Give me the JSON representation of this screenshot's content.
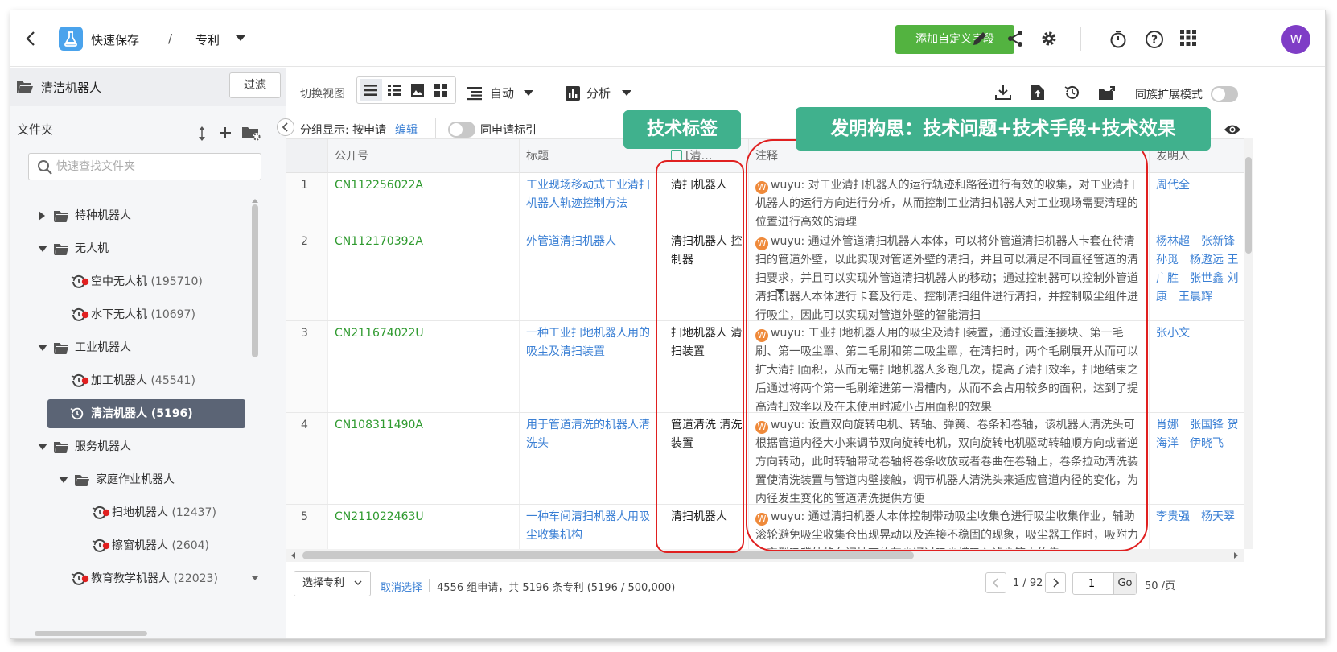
{
  "header": {
    "project": "快速保存",
    "separator": "/",
    "module": "专利",
    "add_field_button": "添加自定义字段",
    "avatar_initial": "W",
    "accent_color": "#53b340"
  },
  "left_panel": {
    "current_folder": "清洁机器人",
    "filter_button": "过滤",
    "folder_label": "文件夹",
    "search_placeholder": "快速查找文件夹",
    "tree": [
      {
        "label": "特种机器人",
        "count": ""
      },
      {
        "label": "无人机",
        "count": ""
      },
      {
        "label": "空中无人机",
        "count": "(195710)"
      },
      {
        "label": "水下无人机",
        "count": "(10697)"
      },
      {
        "label": "工业机器人",
        "count": ""
      },
      {
        "label": "加工机器人",
        "count": "(45541)"
      },
      {
        "label": "清洁机器人",
        "count": "(5196)"
      },
      {
        "label": "服务机器人",
        "count": ""
      },
      {
        "label": "家庭作业机器人",
        "count": ""
      },
      {
        "label": "扫地机器人",
        "count": "(12437)"
      },
      {
        "label": "擦窗机器人",
        "count": "(2604)"
      },
      {
        "label": "教育教学机器人",
        "count": "(22023)"
      }
    ]
  },
  "toolbar": {
    "switch_view": "切换视图",
    "auto": "自动",
    "analysis": "分析",
    "family_mode": "同族扩展模式",
    "group_display": "分组显示: 按申请",
    "edit": "编辑",
    "same_app_index": "同申请标引"
  },
  "table": {
    "columns": [
      "公开号",
      "标题",
      "[清…",
      "注释",
      "发明人"
    ],
    "rows": [
      {
        "index": "1",
        "pub_no": "CN112256022A",
        "title": "工业现场移动式工业清扫机器人轨迹控制方法",
        "tags": "清扫机器人",
        "note_user": "wuyu:",
        "note": "对工业清扫机器人的运行轨迹和路径进行有效的收集，对工业清扫机器人的运行方向进行分析，从而控制工业清扫机器人对工业现场需要清理的位置进行高效的清理",
        "inventors": "周代全"
      },
      {
        "index": "2",
        "pub_no": "CN112170392A",
        "title": "外管道清扫机器人",
        "tags": "清扫机器人 控制器",
        "note_user": "wuyu:",
        "note": "通过外管道清扫机器人本体，可以将外管道清扫机器人卡套在待清扫的管道外壁，以此实现对管道外壁的清扫，并且可以满足不同直径管道的清扫要求，并且可以实现外管道清扫机器人的移动；通过控制器可以控制外管道清扫机器人本体进行卡套及行走、控制清扫组件进行清扫，并控制吸尘组件进行吸尘，因此可以实现对管道外壁的智能清扫",
        "inventors": "杨林超　张新锋 孙觅　杨遨远 王广胜　张世鑫 刘康　王晨辉"
      },
      {
        "index": "3",
        "pub_no": "CN211674022U",
        "title": "一种工业扫地机器人用的吸尘及清扫装置",
        "tags": "扫地机器人 清扫装置",
        "note_user": "wuyu:",
        "note": "工业扫地机器人用的吸尘及清扫装置，通过设置连接块、第一毛刷、第一吸尘罩、第二毛刷和第二吸尘罩，在清扫时，两个毛刷展开从而可以扩大清扫面积，从而无需扫地机器人多跑几次，提高了清扫效率，扫地结束之后通过将两个第一毛刷缩进第一滑槽内，从而不会占用较多的面积，达到了提高清扫效率以及在未使用时减小占用面积的效果",
        "inventors": "张小文"
      },
      {
        "index": "4",
        "pub_no": "CN108311490A",
        "title": "用于管道清洗的机器人清洗头",
        "tags": "管道清洗 清洗装置",
        "note_user": "wuyu:",
        "note": "设置双向旋转电机、转轴、弹簧、卷条和卷轴，该机器人清洗头可根据管道内径大小来调节双向旋转电机，双向旋转电机驱动转轴顺方向或者逆方向转动，此时转轴带动卷轴将卷条收放或者卷曲在卷轴上，卷条拉动清洗装置使清洗装置与管道内壁接触，调节机器人清洗头来适应管道内径的变化，为内径发生变化的管道清洗提供方便",
        "inventors": "肖娜　张国锋 贺海洋　伊晓飞"
      },
      {
        "index": "5",
        "pub_no": "CN211022463U",
        "title": "一种车间清扫机器人用吸尘收集机构",
        "tags": "清扫机器人",
        "note_user": "wuyu:",
        "note": "通过清扫机器人本体控制带动吸尘收集仓进行吸尘收集作业，辅助滚轮避免吸尘收集仓出现晃动以及连接不稳固的现象，吸尘器工作时，吸附力由定型吸嘴处将车间地面的灰尘通过吸尘槽吸入滤尘箱内的集",
        "inventors": "李贵强　杨天翠"
      }
    ]
  },
  "footer": {
    "select_patent": "选择专利",
    "cancel_select": "取消选择",
    "summary": "4556 组申请，共 5196 条专利 (5196 / 500,000)",
    "page_info": "1 / 92",
    "page_input": "1",
    "go": "Go",
    "per_page": "50 /页"
  },
  "annotations": {
    "tech_tag": "技术标签",
    "invention_concept": "发明构思：技术问题+技术手段+技术效果",
    "callout_color": "#40b18d",
    "box_color": "#e02020"
  }
}
